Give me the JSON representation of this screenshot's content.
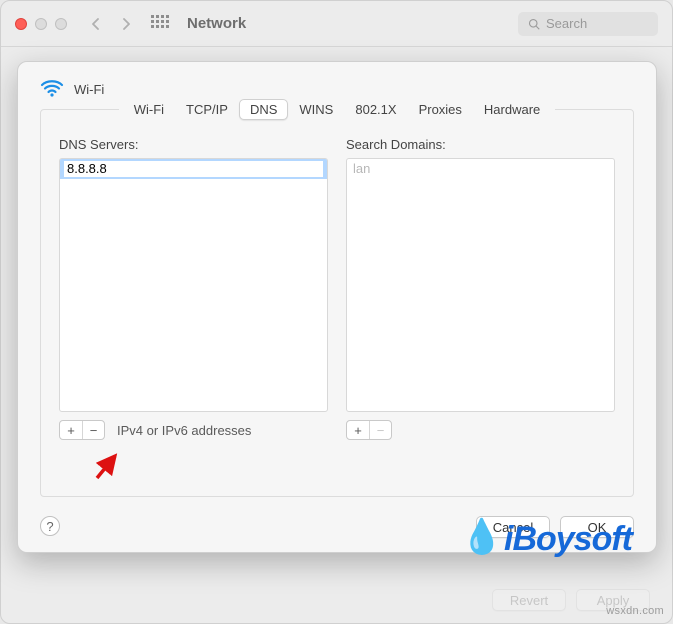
{
  "titlebar": {
    "title": "Network",
    "search_placeholder": "Search"
  },
  "sheet": {
    "title": "Wi-Fi",
    "tabs": [
      "Wi-Fi",
      "TCP/IP",
      "DNS",
      "WINS",
      "802.1X",
      "Proxies",
      "Hardware"
    ],
    "active_tab_index": 2,
    "dns": {
      "label": "DNS Servers:",
      "entry_value": "8.8.8.8",
      "footer_hint": "IPv4 or IPv6 addresses",
      "add_label": "+",
      "remove_label": "−"
    },
    "search_domains": {
      "label": "Search Domains:",
      "placeholder_item": "lan",
      "add_label": "+",
      "remove_label": "−"
    },
    "buttons": {
      "cancel": "Cancel",
      "ok": "OK"
    },
    "help_label": "?"
  },
  "bottom": {
    "revert": "Revert",
    "apply": "Apply"
  },
  "watermark_text": "iBoysoft",
  "source_label": "wsxdn.com"
}
